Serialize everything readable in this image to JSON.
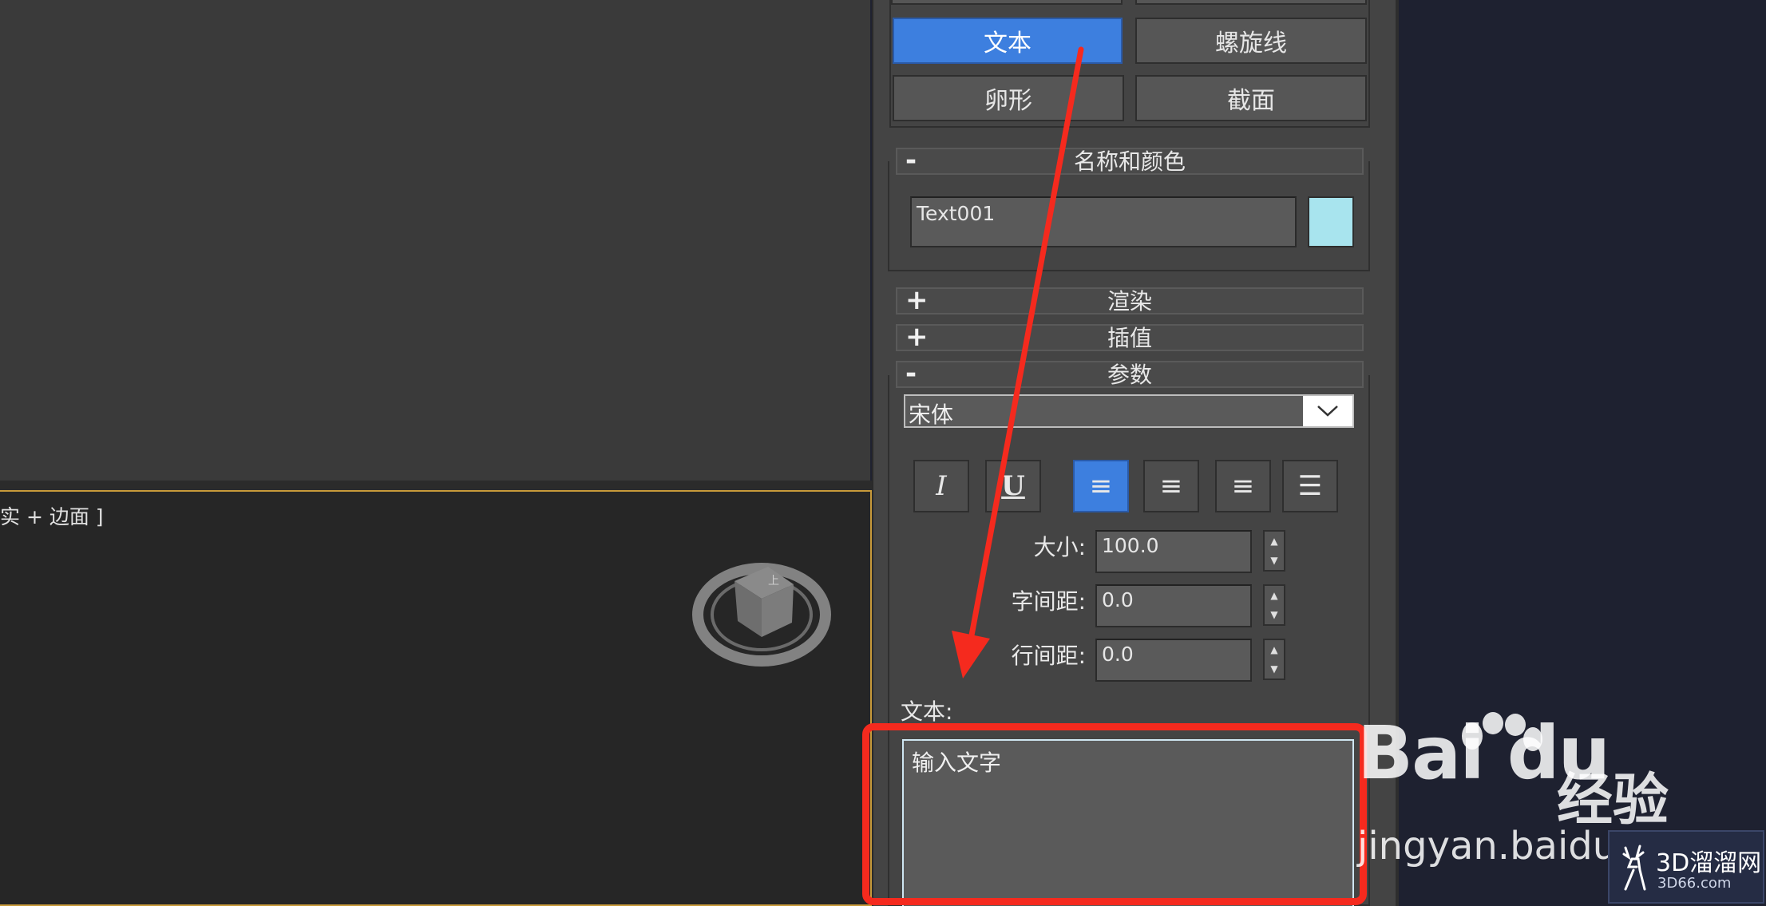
{
  "viewport": {
    "label": "实 + 边面 ]"
  },
  "object_type": {
    "buttons": [
      "文本",
      "螺旋线",
      "卵形",
      "截面"
    ],
    "active": "文本"
  },
  "name_and_color": {
    "title": "名称和颜色",
    "sign": "-",
    "name_value": "Text001",
    "color": "#a8e4ee"
  },
  "rollouts": {
    "render": {
      "sign": "+",
      "title": "渲染"
    },
    "interpolation": {
      "sign": "+",
      "title": "插值"
    },
    "parameters": {
      "sign": "-",
      "title": "参数"
    }
  },
  "parameters": {
    "font": "宋体",
    "format_buttons": [
      "italic-icon",
      "underline-icon",
      "align-left-icon",
      "align-center-icon",
      "align-right-icon",
      "justify-icon"
    ],
    "active_format": "align-left-icon",
    "size_label": "大小:",
    "size_value": "100.0",
    "kerning_label": "字间距:",
    "kerning_value": "0.0",
    "leading_label": "行间距:",
    "leading_value": "0.0",
    "text_label": "文本:",
    "text_value": "输入文字"
  },
  "annotation": {
    "color": "#f52a1e"
  },
  "watermark": {
    "baidu_brand": "Bai  du",
    "baidu_suffix": "经验",
    "baidu_url": "jingyan.baidu.c",
    "site_name": "3D溜溜网",
    "site_url": "3D66.com"
  }
}
